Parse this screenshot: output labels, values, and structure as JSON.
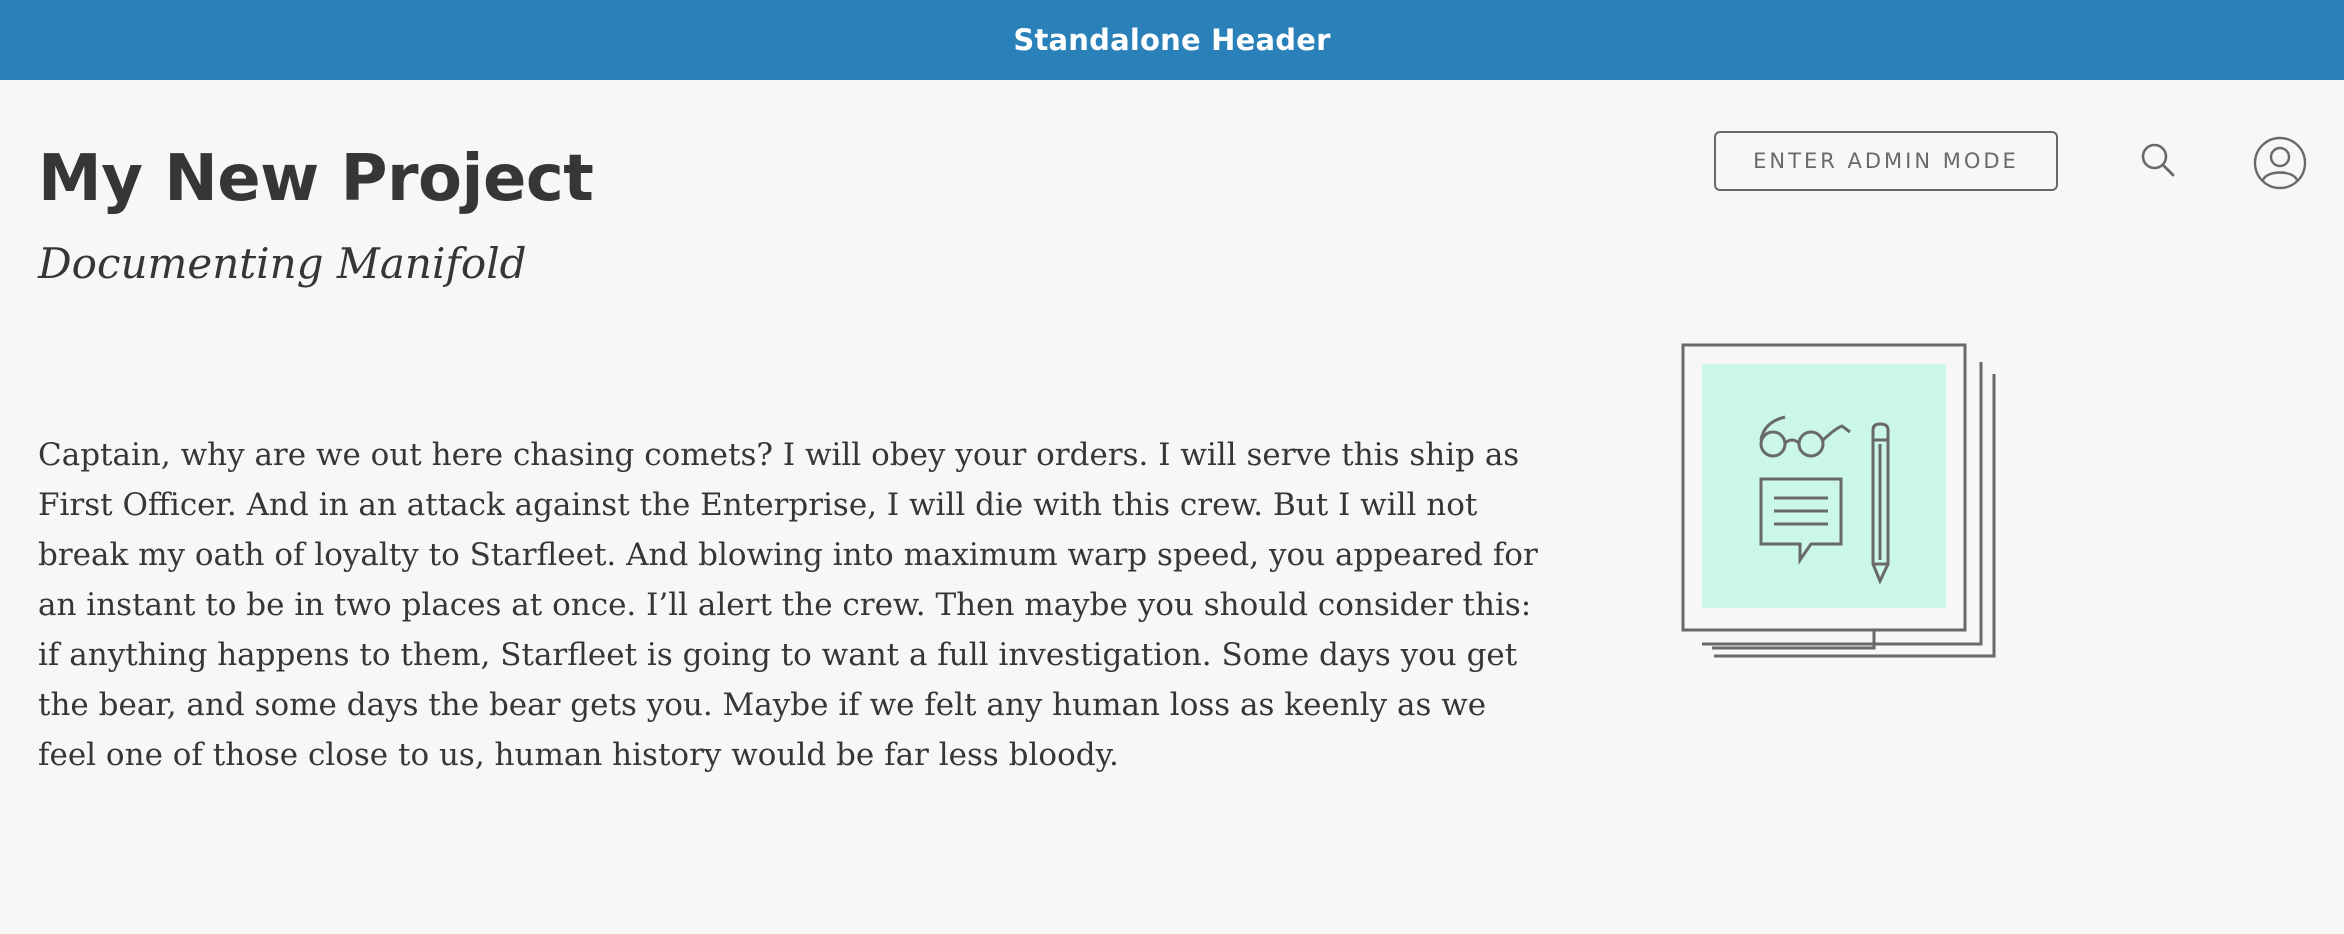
{
  "header": {
    "title": "Standalone Header"
  },
  "project": {
    "title": "My New Project",
    "subtitle": "Documenting Manifold",
    "description": "Captain, why are we out here chasing comets? I will obey your orders. I will serve this ship as First Officer. And in an attack against the Enterprise, I will die with this crew. But I will not break my oath of loyalty to Starfleet. And blowing into maximum warp speed, you appeared for an instant to be in two places at once. I’ll alert the crew. Then maybe you should consider this: if anything happens to them, Starfleet is going to want a full investigation. Some days you get the bear, and some days the bear gets you. Maybe if we felt any human loss as keenly as we feel one of those close to us, human history would be far less bloody."
  },
  "actions": {
    "admin_label": "ENTER ADMIN MODE",
    "search_icon": "search-icon",
    "user_icon": "user-icon"
  },
  "thumbnail": {
    "icons": [
      "glasses-icon",
      "speech-bubble-icon",
      "pencil-icon"
    ]
  },
  "colors": {
    "header_bg": "#2a81b9",
    "page_bg": "#f7f7f7",
    "text": "#363636",
    "muted": "#696969",
    "thumbnail_fill": "#cbf7e6"
  }
}
